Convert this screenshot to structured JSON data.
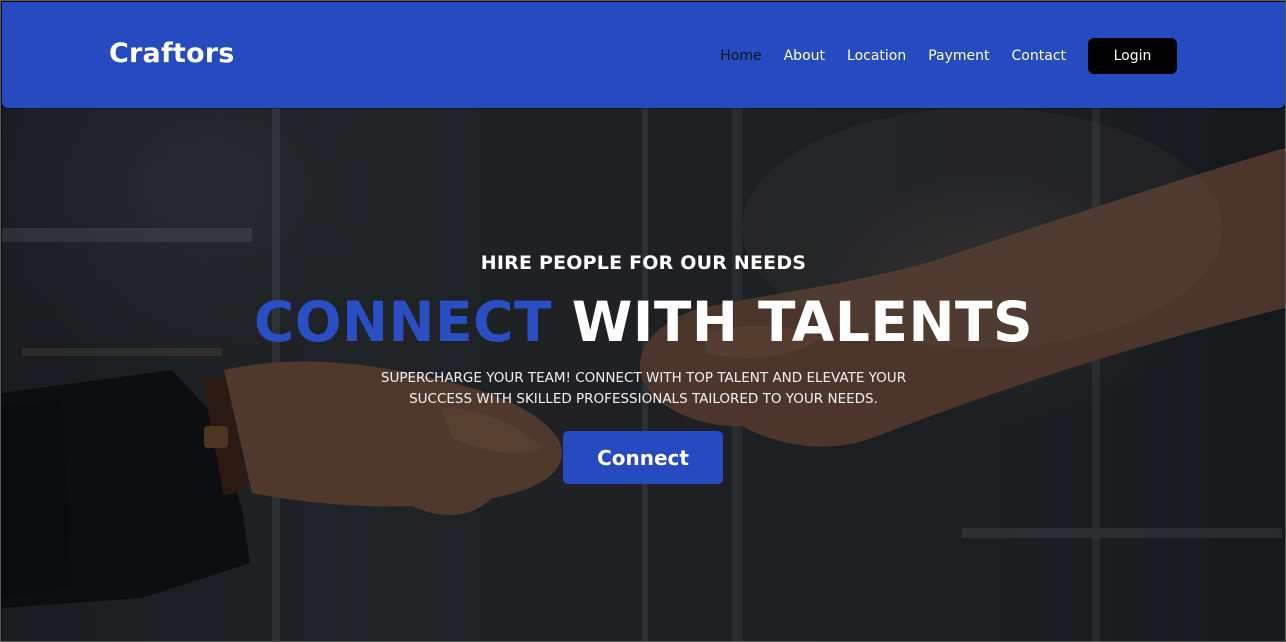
{
  "header": {
    "brand": "Craftors",
    "nav": [
      {
        "label": "Home",
        "active": true
      },
      {
        "label": "About",
        "active": false
      },
      {
        "label": "Location",
        "active": false
      },
      {
        "label": "Payment",
        "active": false
      },
      {
        "label": "Contact",
        "active": false
      }
    ],
    "login_label": "Login"
  },
  "hero": {
    "eyebrow": "HIRE PEOPLE FOR OUR NEEDS",
    "headline_accent": "CONNECT",
    "headline_rest": "WITH TALENTS",
    "subtext_line1": "SUPERCHARGE YOUR TEAM! CONNECT WITH TOP TALENT AND ELEVATE YOUR",
    "subtext_line2": "SUCCESS WITH SKILLED PROFESSIONALS TAILORED TO YOUR NEEDS.",
    "cta_label": "Connect",
    "background_image": "handshake-fist-bump-photo"
  },
  "colors": {
    "brand_blue": "#264bc0",
    "accent_text": "#2a4fc4",
    "login_bg": "#000000",
    "active_nav": "#0b1020"
  }
}
